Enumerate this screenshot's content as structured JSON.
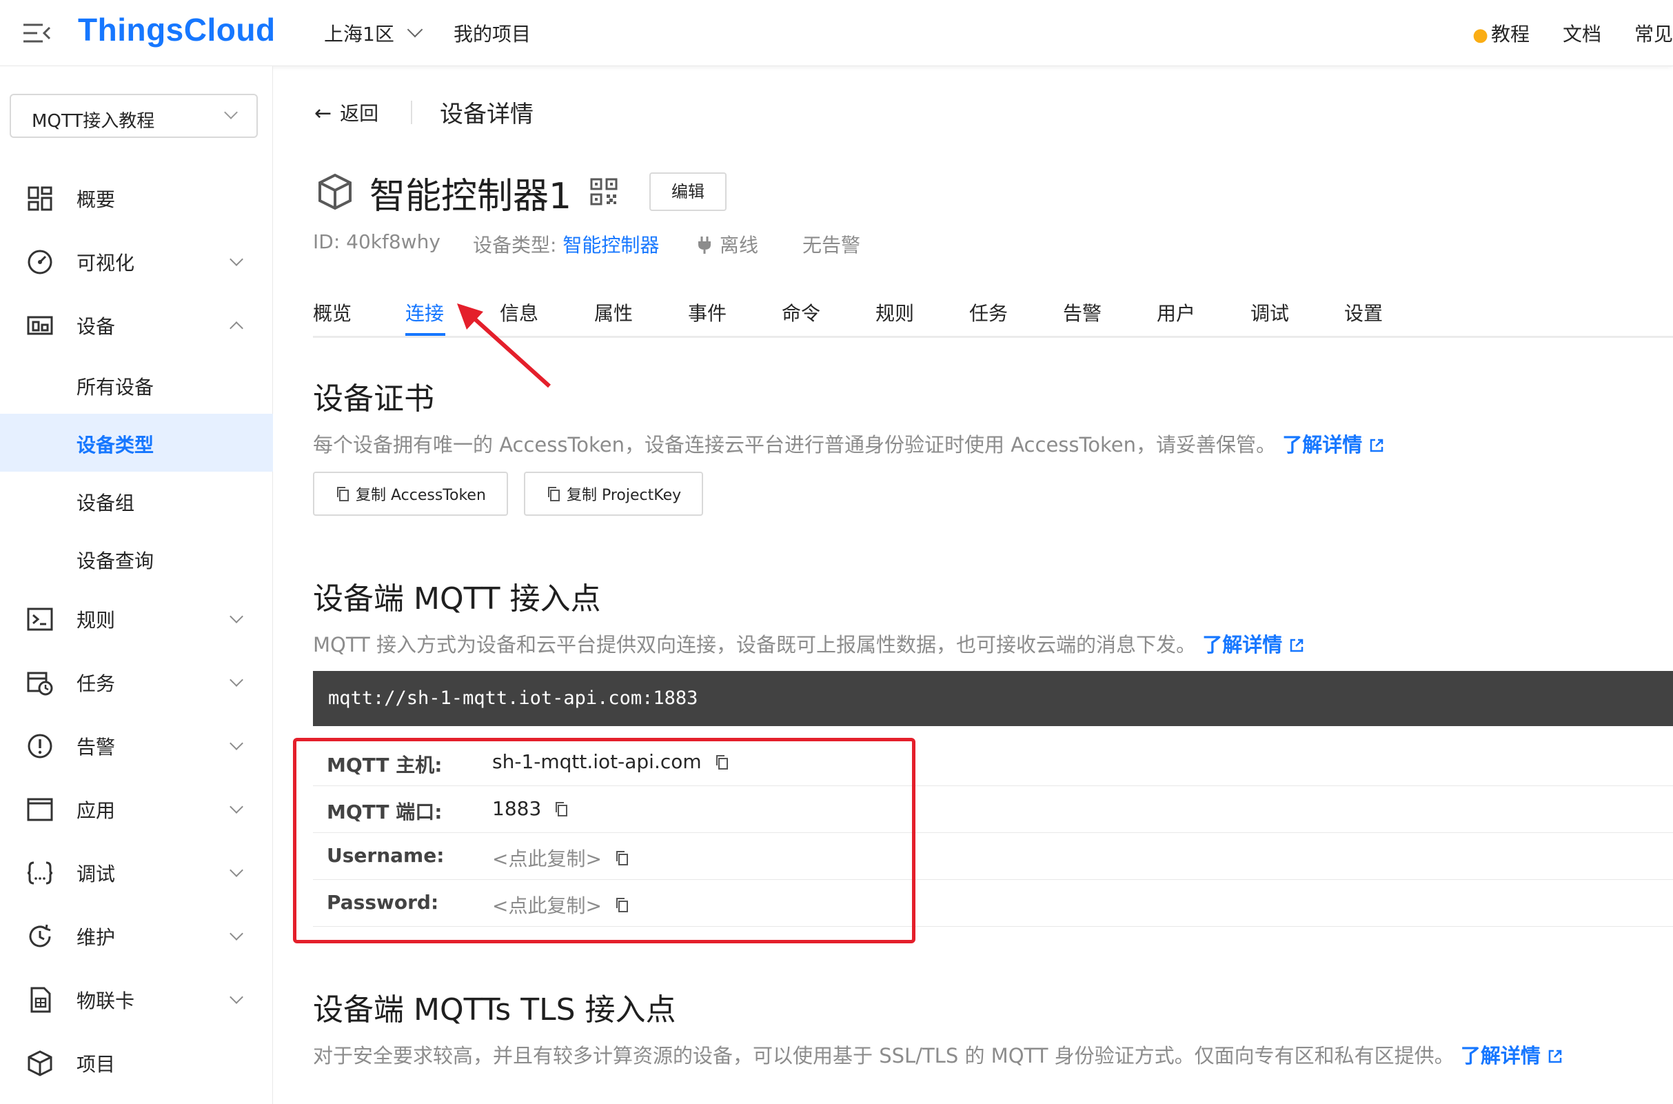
{
  "header": {
    "logo": "ThingsCloud",
    "region": "上海1区",
    "my_projects": "我的项目",
    "tutorial": "教程",
    "docs": "文档",
    "faq": "常见"
  },
  "sidebar": {
    "project": "MQTT接入教程",
    "items": [
      {
        "label": "概要"
      },
      {
        "label": "可视化"
      },
      {
        "label": "设备"
      },
      {
        "label": "规则"
      },
      {
        "label": "任务"
      },
      {
        "label": "告警"
      },
      {
        "label": "应用"
      },
      {
        "label": "调试"
      },
      {
        "label": "维护"
      },
      {
        "label": "物联卡"
      },
      {
        "label": "项目"
      }
    ],
    "device_sub": [
      {
        "label": "所有设备"
      },
      {
        "label": "设备类型"
      },
      {
        "label": "设备组"
      },
      {
        "label": "设备查询"
      }
    ]
  },
  "page": {
    "back": "返回",
    "title": "设备详情"
  },
  "device": {
    "name": "智能控制器1",
    "edit": "编辑",
    "id": "ID: 40kf8why",
    "type_label": "设备类型:",
    "type_value": "智能控制器",
    "status": "离线",
    "alarm": "无告警"
  },
  "tabs": [
    "概览",
    "连接",
    "信息",
    "属性",
    "事件",
    "命令",
    "规则",
    "任务",
    "告警",
    "用户",
    "调试",
    "设置"
  ],
  "cert": {
    "title": "设备证书",
    "desc": "每个设备拥有唯一的 AccessToken，设备连接云平台进行普通身份验证时使用 AccessToken，请妥善保管。",
    "learn_more": "了解详情",
    "copy_token": "复制 AccessToken",
    "copy_key": "复制 ProjectKey"
  },
  "mqtt": {
    "title": "设备端 MQTT 接入点",
    "desc": "MQTT 接入方式为设备和云平台提供双向连接，设备既可上报属性数据，也可接收云端的消息下发。",
    "learn_more": "了解详情",
    "url": "mqtt://sh-1-mqtt.iot-api.com:1883",
    "rows": [
      {
        "key": "MQTT 主机:",
        "value": "sh-1-mqtt.iot-api.com"
      },
      {
        "key": "MQTT 端口:",
        "value": "1883"
      },
      {
        "key": "Username:",
        "value": "<点此复制>"
      },
      {
        "key": "Password:",
        "value": "<点此复制>"
      }
    ]
  },
  "mqtts": {
    "title": "设备端 MQTTs TLS 接入点",
    "desc": "对于安全要求较高，并且有较多计算资源的设备，可以使用基于 SSL/TLS 的 MQTT 身份验证方式。仅面向专有区和私有区提供。",
    "learn_more": "了解详情"
  },
  "colors": {
    "brand": "#1677ff",
    "annotation": "#e41f2b",
    "code_bg": "#424242"
  }
}
